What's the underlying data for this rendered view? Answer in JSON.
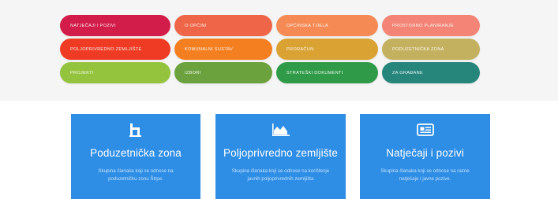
{
  "pills": [
    {
      "label": "NATJEČAJI I POZIVI",
      "color": "#d21d4a"
    },
    {
      "label": "O OPĆINI",
      "color": "#ef6548"
    },
    {
      "label": "OPĆINSKA TIJELA",
      "color": "#f58a55"
    },
    {
      "label": "PROSTORNO PLANIRANJE",
      "color": "#f38476"
    },
    {
      "label": "POLJOPRIVREDNO ZEMLJIŠTE",
      "color": "#ef3b24"
    },
    {
      "label": "KOMUNALNI SUSTAV",
      "color": "#f47f20"
    },
    {
      "label": "PRORAČUN",
      "color": "#d9a233"
    },
    {
      "label": "PODUZETNIČKA ZONA",
      "color": "#c4b15f"
    },
    {
      "label": "PROJEKTI",
      "color": "#94c33d"
    },
    {
      "label": "IZBORI",
      "color": "#6ba23d"
    },
    {
      "label": "STRATEŠKI DOKUMENTI",
      "color": "#2f9a47"
    },
    {
      "label": "ZA GRAĐANE",
      "color": "#27867c"
    }
  ],
  "cards": [
    {
      "title": "Poduzetnička zona",
      "description": "Skupina članaka koji se odnose na poduzetničku zonu Štrpe.",
      "icon": "building-icon"
    },
    {
      "title": "Poljoprivredno zemljište",
      "description": "Skupina članaka koji se odnose na korištenje javnih poljoprivrednih zemljišta",
      "icon": "area-chart-icon"
    },
    {
      "title": "Natječaji i pozivi",
      "description": "Skupina članaka koji se odnose na razne natječaje i javne pozive.",
      "icon": "newspaper-icon"
    }
  ]
}
